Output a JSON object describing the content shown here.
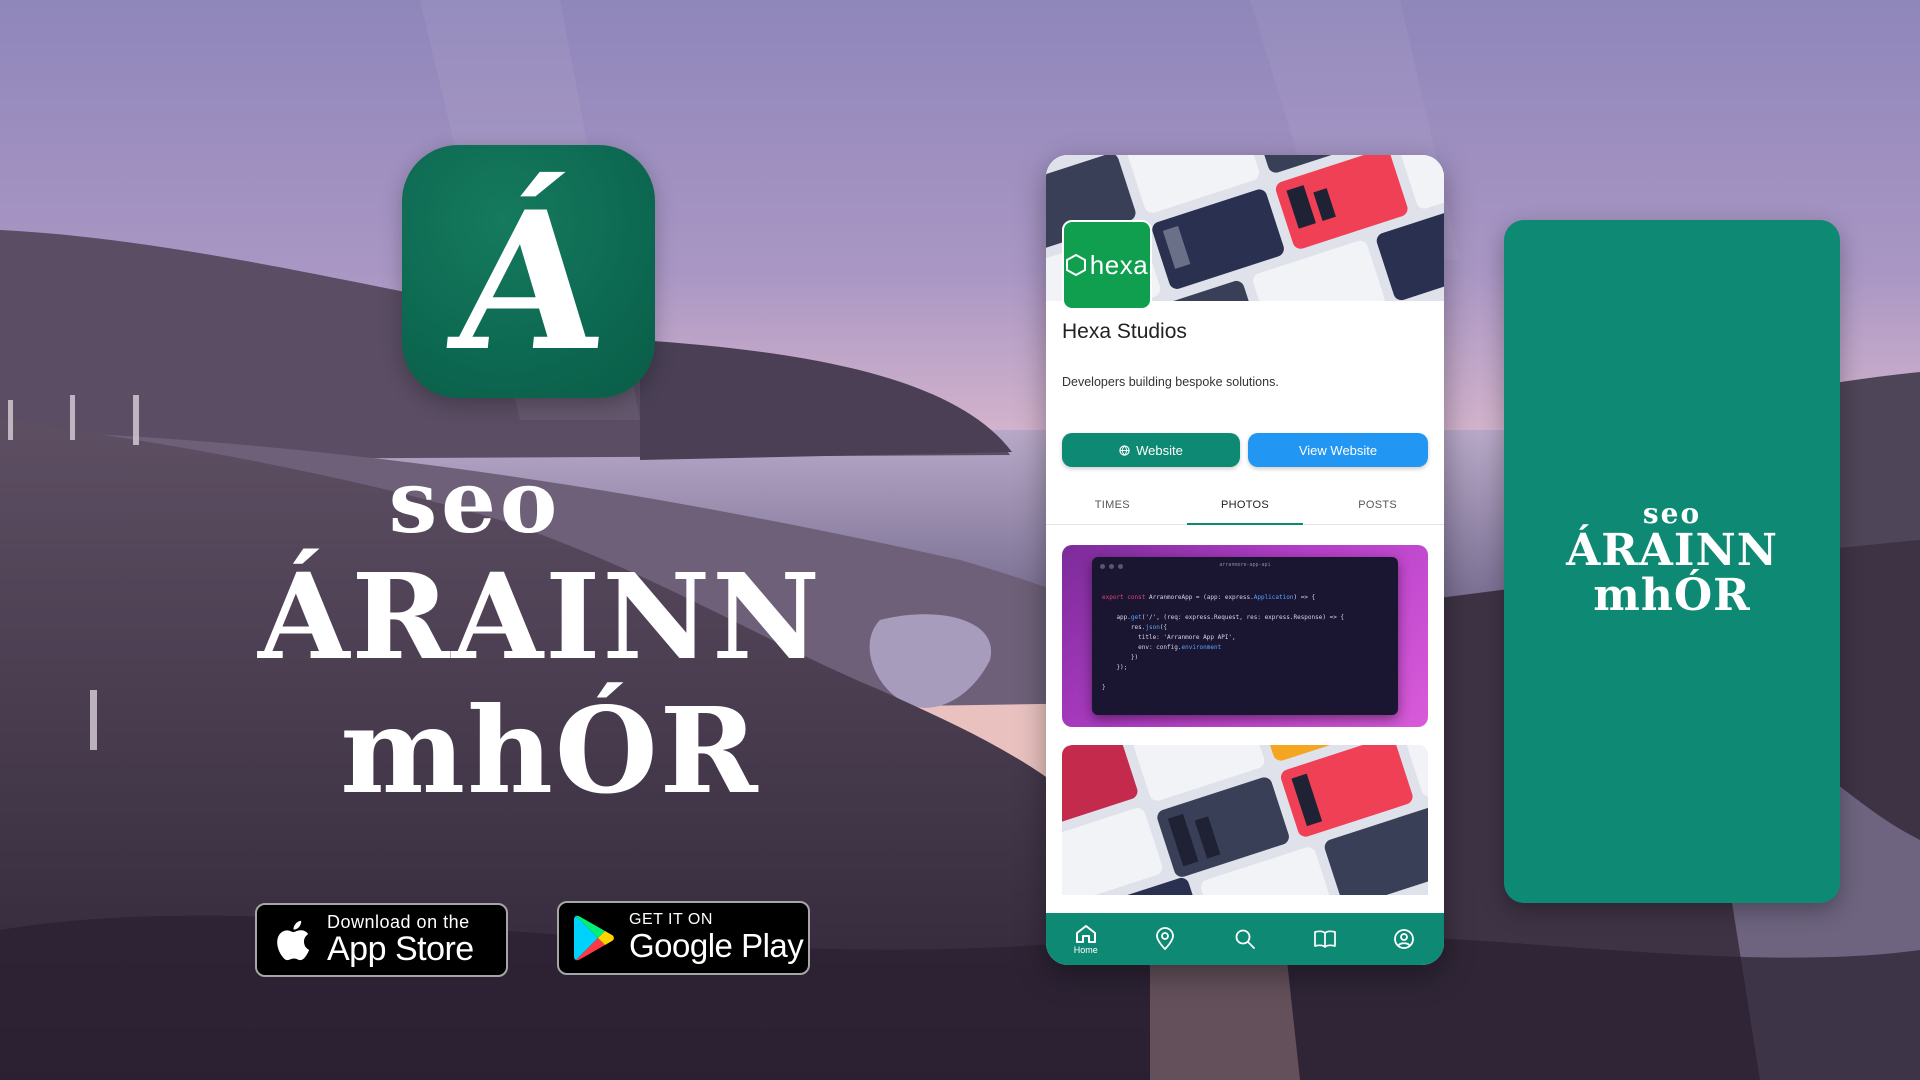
{
  "app": {
    "icon_letter": "Á",
    "title_line1": "seo",
    "title_line2": "ÁRAINN",
    "title_line3": "mhÓR"
  },
  "store_badges": {
    "apple": {
      "small": "Download on the",
      "big": "App Store"
    },
    "google": {
      "small": "GET IT ON",
      "big": "Google Play"
    }
  },
  "phone": {
    "profile": {
      "logo_text": "hexa",
      "name": "Hexa Studios",
      "description": "Developers building bespoke solutions."
    },
    "buttons": {
      "website": "Website",
      "view_website": "View Website"
    },
    "tabs": [
      {
        "label": "TIMES"
      },
      {
        "label": "PHOTOS",
        "active": true
      },
      {
        "label": "POSTS"
      }
    ],
    "code_window": {
      "title": "arranmore-app-api"
    },
    "bottom_nav": [
      {
        "icon": "home-icon",
        "label": "Home"
      },
      {
        "icon": "map-pin-icon",
        "label": ""
      },
      {
        "icon": "search-icon",
        "label": ""
      },
      {
        "icon": "book-icon",
        "label": ""
      },
      {
        "icon": "profile-icon",
        "label": ""
      }
    ]
  },
  "splash": {
    "line1": "seo",
    "line2": "ÁRAINN",
    "line3": "mhÓR"
  },
  "colors": {
    "brand_green": "#0e8a74",
    "icon_green": "#0d6a52",
    "view_button_blue": "#2196f3",
    "hexa_green": "#0f9f4f"
  }
}
